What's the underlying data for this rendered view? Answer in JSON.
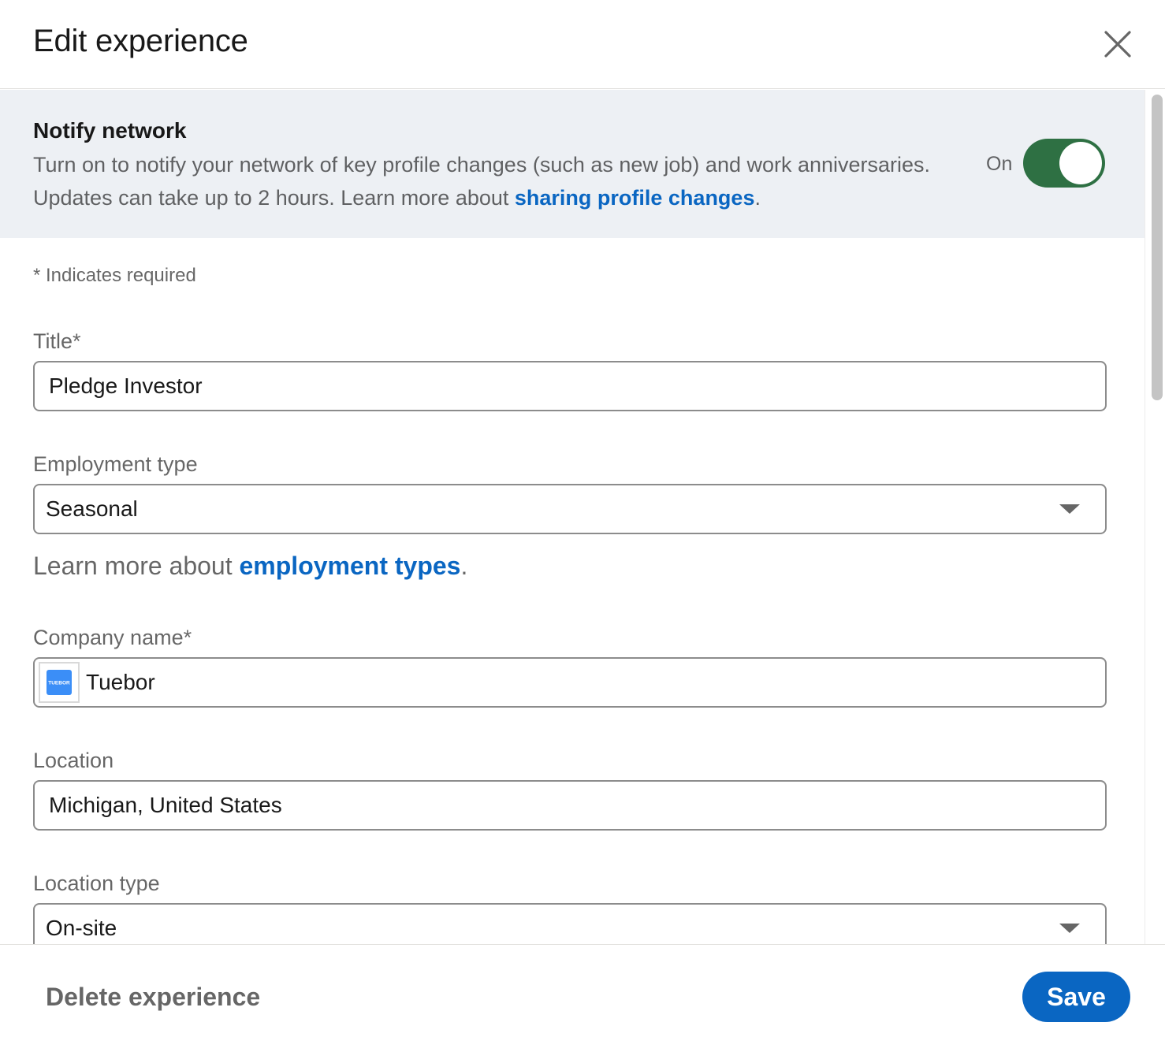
{
  "header": {
    "title": "Edit experience",
    "close_icon": "close-icon"
  },
  "notify": {
    "title": "Notify network",
    "desc_prefix": "Turn on to notify your network of key profile changes (such as new job) and work anniversaries. Updates can take up to 2 hours. Learn more about ",
    "desc_link": "sharing profile changes",
    "desc_suffix": ".",
    "toggle_label": "On",
    "toggle_on": true
  },
  "form": {
    "required_note": "* Indicates required",
    "title_label": "Title*",
    "title_value": "Pledge Investor",
    "employment_label": "Employment type",
    "employment_value": "Seasonal",
    "employment_learn_prefix": "Learn more about ",
    "employment_learn_link": "employment types",
    "employment_learn_suffix": ".",
    "company_label": "Company name*",
    "company_value": "Tuebor",
    "company_logo_text": "TUEBOR",
    "location_label": "Location",
    "location_value": "Michigan, United States",
    "location_type_label": "Location type",
    "location_type_value": "On-site"
  },
  "footer": {
    "delete_label": "Delete experience",
    "save_label": "Save"
  },
  "colors": {
    "accent": "#0a66c2",
    "toggle_on": "#2e7043",
    "banner_bg": "#edf0f4",
    "company_logo_bg": "#3b8ef7"
  }
}
